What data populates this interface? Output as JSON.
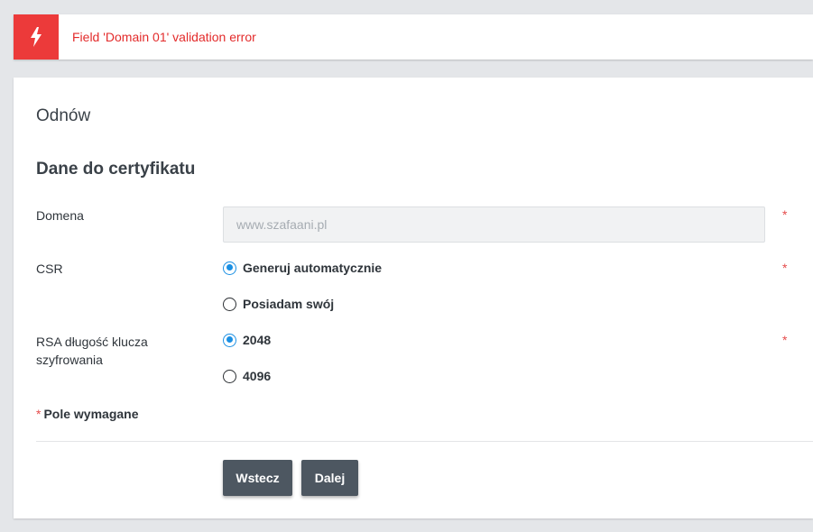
{
  "alert": {
    "icon": "lightning-bolt-icon",
    "message": "Field 'Domain 01' validation error",
    "color": "#ec3a3a"
  },
  "page": {
    "title": "Odnów",
    "section_title": "Dane do certyfikatu"
  },
  "form": {
    "domain": {
      "label": "Domena",
      "value": "www.szafaani.pl",
      "required": "*"
    },
    "csr": {
      "label": "CSR",
      "required": "*",
      "options": [
        {
          "label": "Generuj automatycznie",
          "checked": true
        },
        {
          "label": "Posiadam swój",
          "checked": false
        }
      ]
    },
    "rsa": {
      "label_line1": "RSA długość klucza",
      "label_line2": "szyfrowania",
      "required": "*",
      "options": [
        {
          "label": "2048",
          "checked": true
        },
        {
          "label": "4096",
          "checked": false
        }
      ]
    },
    "required_note": {
      "star": "*",
      "text": "Pole wymagane"
    }
  },
  "buttons": {
    "back": "Wstecz",
    "next": "Dalej"
  },
  "colors": {
    "accent": "#1a8fe3",
    "button": "#4d5761",
    "error": "#e32b2b"
  }
}
